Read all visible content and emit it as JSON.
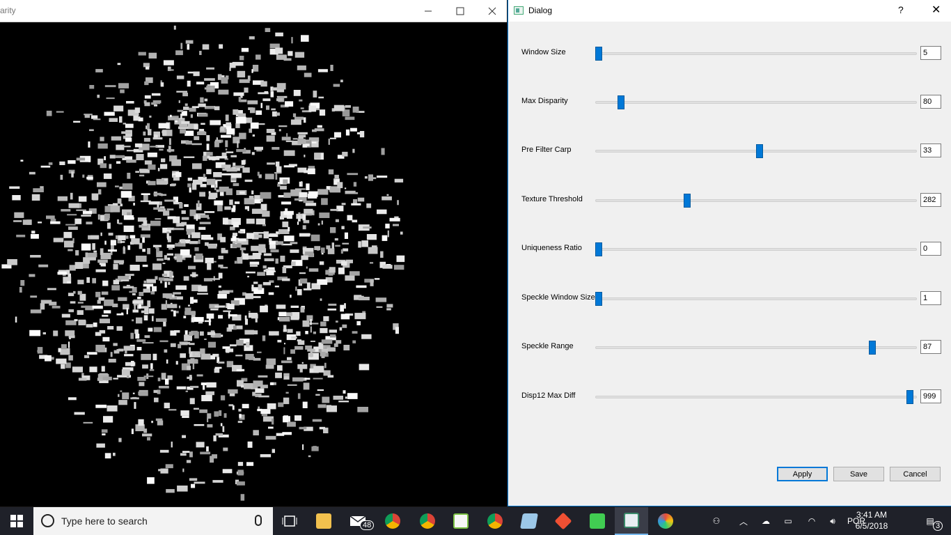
{
  "disparity_window": {
    "title": "arity"
  },
  "dialog": {
    "title": "Dialog",
    "help_glyph": "?",
    "close_glyph": "✕",
    "params": [
      {
        "label": "Window Size",
        "value": "5",
        "slider_fraction": 0.0
      },
      {
        "label": "Max Disparity",
        "value": "80",
        "slider_fraction": 0.07
      },
      {
        "label": "Pre Filter Carp",
        "value": "33",
        "slider_fraction": 0.51
      },
      {
        "label": "Texture Threshold",
        "value": "282",
        "slider_fraction": 0.28
      },
      {
        "label": "Uniqueness Ratio",
        "value": "0",
        "slider_fraction": 0.0
      },
      {
        "label": "Speckle Window Size",
        "value": "1",
        "slider_fraction": 0.0
      },
      {
        "label": "Speckle Range",
        "value": "87",
        "slider_fraction": 0.87
      },
      {
        "label": "Disp12 Max Diff",
        "value": "999",
        "slider_fraction": 0.99
      }
    ],
    "buttons": {
      "apply": "Apply",
      "save": "Save",
      "cancel": "Cancel"
    }
  },
  "taskbar": {
    "search_placeholder": "Type here to search",
    "mail_badge": "48",
    "language": "POR",
    "time": "3:41 AM",
    "date": "6/5/2018",
    "notification_count": "3"
  },
  "colors": {
    "accent": "#0078d7",
    "dialog_bg": "#f0f0f0",
    "taskbar_bg": "#1f2129"
  }
}
